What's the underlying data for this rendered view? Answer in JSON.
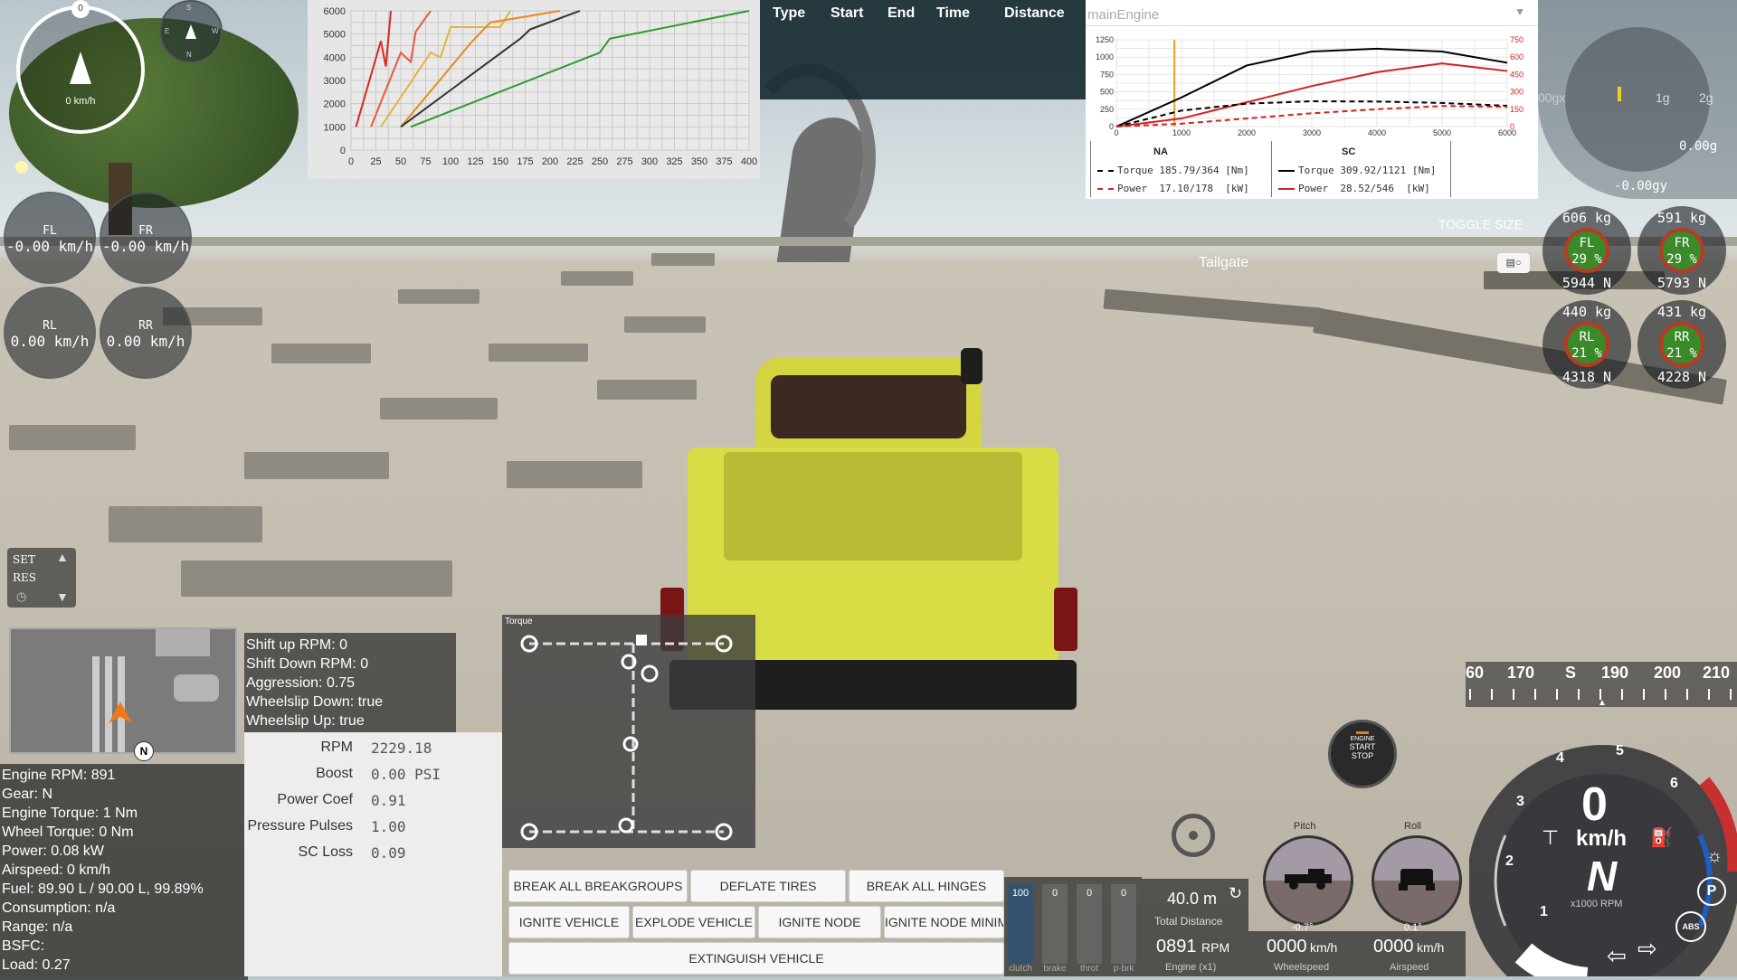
{
  "compass": {
    "speed": "0 km/h",
    "north": "0",
    "small_labels": [
      "S",
      "E",
      "W",
      "N"
    ]
  },
  "wheel_speeds": [
    {
      "name": "FL",
      "value": "-0.00 km/h"
    },
    {
      "name": "FR",
      "value": "-0.00 km/h"
    },
    {
      "name": "RL",
      "value": "0.00 km/h"
    },
    {
      "name": "RR",
      "value": "0.00 km/h"
    }
  ],
  "shift_chart": {
    "type": "line",
    "x_ticks": [
      "0",
      "25",
      "50",
      "75",
      "100",
      "125",
      "150",
      "175",
      "200",
      "225",
      "250",
      "275",
      "300",
      "325",
      "350",
      "375",
      "400"
    ],
    "y_ticks": [
      "0",
      "1000",
      "2000",
      "3000",
      "4000",
      "5000",
      "6000"
    ],
    "xlim": [
      0,
      400
    ],
    "ylim": [
      0,
      6000
    ],
    "series": [
      {
        "color": "#d62a1e",
        "x": [
          5,
          30,
          35,
          40
        ],
        "y": [
          1000,
          4700,
          3600,
          6000
        ]
      },
      {
        "color": "#e85a3a",
        "x": [
          20,
          50,
          60,
          65,
          80
        ],
        "y": [
          1000,
          4200,
          3800,
          5100,
          6000
        ]
      },
      {
        "color": "#e6b437",
        "x": [
          30,
          80,
          90,
          100,
          150,
          160
        ],
        "y": [
          1000,
          4200,
          4000,
          5300,
          5300,
          6000
        ]
      },
      {
        "color": "#e88a1e",
        "x": [
          50,
          120,
          140,
          210
        ],
        "y": [
          1000,
          4600,
          5500,
          6000
        ]
      },
      {
        "color": "#333333",
        "x": [
          50,
          170,
          180,
          230
        ],
        "y": [
          1000,
          4800,
          5200,
          6000
        ]
      },
      {
        "color": "#2e9a2e",
        "x": [
          60,
          250,
          260,
          400
        ],
        "y": [
          1000,
          4200,
          4800,
          6000
        ]
      }
    ]
  },
  "drag_table": {
    "headers": [
      "Type",
      "Start",
      "End",
      "Time",
      "Distance"
    ]
  },
  "engine_chart": {
    "type": "line",
    "dropdown_value": "mainEngine",
    "left_ticks": [
      "0",
      "250",
      "500",
      "750",
      "1000",
      "1250"
    ],
    "right_ticks": [
      "0",
      "150",
      "300",
      "450",
      "600",
      "750"
    ],
    "x_ticks": [
      "0",
      "1000",
      "2000",
      "3000",
      "4000",
      "5000",
      "6000"
    ],
    "xlim": [
      0,
      6000
    ],
    "ylim_left": [
      0,
      1250
    ],
    "ylim_right": [
      0,
      750
    ],
    "cursor_rpm": 891,
    "series": [
      {
        "label": "SC Torque",
        "color": "#000000",
        "dash": false,
        "x": [
          0,
          1000,
          2000,
          3000,
          4000,
          5000,
          6000
        ],
        "y": [
          0,
          420,
          880,
          1080,
          1121,
          1080,
          920
        ]
      },
      {
        "label": "SC Power",
        "color": "#d42222",
        "dash": false,
        "x": [
          0,
          1000,
          2000,
          3000,
          4000,
          5000,
          6000
        ],
        "y": [
          0,
          70,
          210,
          350,
          470,
          546,
          480
        ]
      },
      {
        "label": "NA Torque",
        "color": "#000000",
        "dash": true,
        "x": [
          0,
          1000,
          2000,
          3000,
          4000,
          5000,
          6000
        ],
        "y": [
          0,
          230,
          330,
          364,
          360,
          340,
          300
        ]
      },
      {
        "label": "NA Power",
        "color": "#d42222",
        "dash": true,
        "x": [
          0,
          1000,
          2000,
          3000,
          4000,
          5000,
          6000
        ],
        "y": [
          0,
          25,
          70,
          115,
          150,
          178,
          170
        ]
      }
    ],
    "legend": {
      "na_title": "NA",
      "sc_title": "SC",
      "na_torque": "Torque 185.79/364 [Nm]",
      "na_power": "Power  17.10/178  [kW]",
      "sc_torque": "Torque 309.92/1121 [Nm]",
      "sc_power": "Power  28.52/546  [kW]"
    }
  },
  "gforce": {
    "label_0g": "00gx",
    "label_1g": "1g",
    "label_2g": "2g",
    "gx": "0.00g",
    "gy": "-0.00gy"
  },
  "toggle_size": "TOGGLE SIZE",
  "tailgate": "Tailgate",
  "tyres": [
    {
      "mass": "606 kg",
      "name": "FL",
      "pct": "29 %",
      "force": "5944 N"
    },
    {
      "mass": "591 kg",
      "name": "FR",
      "pct": "29 %",
      "force": "5793 N"
    },
    {
      "mass": "440 kg",
      "name": "RL",
      "pct": "21 %",
      "force": "4318 N"
    },
    {
      "mass": "431 kg",
      "name": "RR",
      "pct": "21 %",
      "force": "4228 N"
    }
  ],
  "cruise": {
    "set": "SET",
    "res": "RES"
  },
  "minimap": {
    "north": "N"
  },
  "shift_info": [
    "Shift up RPM: 0",
    "Shift Down RPM: 0",
    "Aggression: 0.75",
    "Wheelslip Down: true",
    "Wheelslip Up: true"
  ],
  "engine_info": [
    "Engine RPM: 891",
    "Gear: N",
    "Engine Torque: 1 Nm",
    "Wheel Torque: 0 Nm",
    "Power: 0.08 kW",
    "Airspeed: 0 km/h",
    "Fuel: 89.90 L / 90.00 L, 99.89%",
    "Consumption: n/a",
    "Range: n/a",
    "BSFC:",
    "Load: 0.27"
  ],
  "forced_induction": [
    {
      "label": "RPM",
      "value": "2229.18"
    },
    {
      "label": "Boost",
      "value": "0.00 PSI"
    },
    {
      "label": "Power Coef",
      "value": "0.91"
    },
    {
      "label": "Pressure Pulses",
      "value": "1.00"
    },
    {
      "label": "SC Loss",
      "value": "0.09"
    }
  ],
  "torque_panel_title": "Torque",
  "buttons": {
    "break_breakgroups": "BREAK ALL BREAKGROUPS",
    "deflate_tires": "DEFLATE TIRES",
    "break_hinges": "BREAK ALL HINGES",
    "ignite_vehicle": "IGNITE VEHICLE",
    "explode_vehicle": "EXPLODE VEHICLE",
    "ignite_node": "IGNITE NODE",
    "ignite_node_mini": "IGNITE NODE MINIM",
    "extinguish": "EXTINGUISH VEHICLE"
  },
  "inputs": [
    {
      "label": "clutch",
      "value": "100",
      "level": 1.0
    },
    {
      "label": "brake",
      "value": "0",
      "level": 0
    },
    {
      "label": "throt",
      "value": "0",
      "level": 0
    },
    {
      "label": "p-brk",
      "value": "0",
      "level": 0
    }
  ],
  "distance": {
    "value": "40.0 m",
    "label": "Total Distance"
  },
  "rpm_readout": {
    "value": "0891",
    "unit": "RPM",
    "label": "Engine (x1)"
  },
  "wheelspeed": {
    "value": "0000",
    "unit": "km/h",
    "label": "Wheelspeed"
  },
  "airspeed": {
    "value": "0000",
    "unit": "km/h",
    "label": "Airspeed"
  },
  "pitch": {
    "label": "Pitch",
    "value": "-0.7°"
  },
  "roll": {
    "label": "Roll",
    "value": "0.1°"
  },
  "engine_button": {
    "line1": "ENGINE",
    "line2": "START",
    "line3": "STOP"
  },
  "heading_tape": [
    "60",
    "170",
    "S",
    "190",
    "200",
    "210"
  ],
  "tacho": {
    "speed": "0",
    "unit": "km/h",
    "gear": "N",
    "rpm_label": "x1000 RPM",
    "ticks": [
      "1",
      "2",
      "3",
      "4",
      "5",
      "6"
    ],
    "park": "P",
    "abs": "ABS"
  }
}
